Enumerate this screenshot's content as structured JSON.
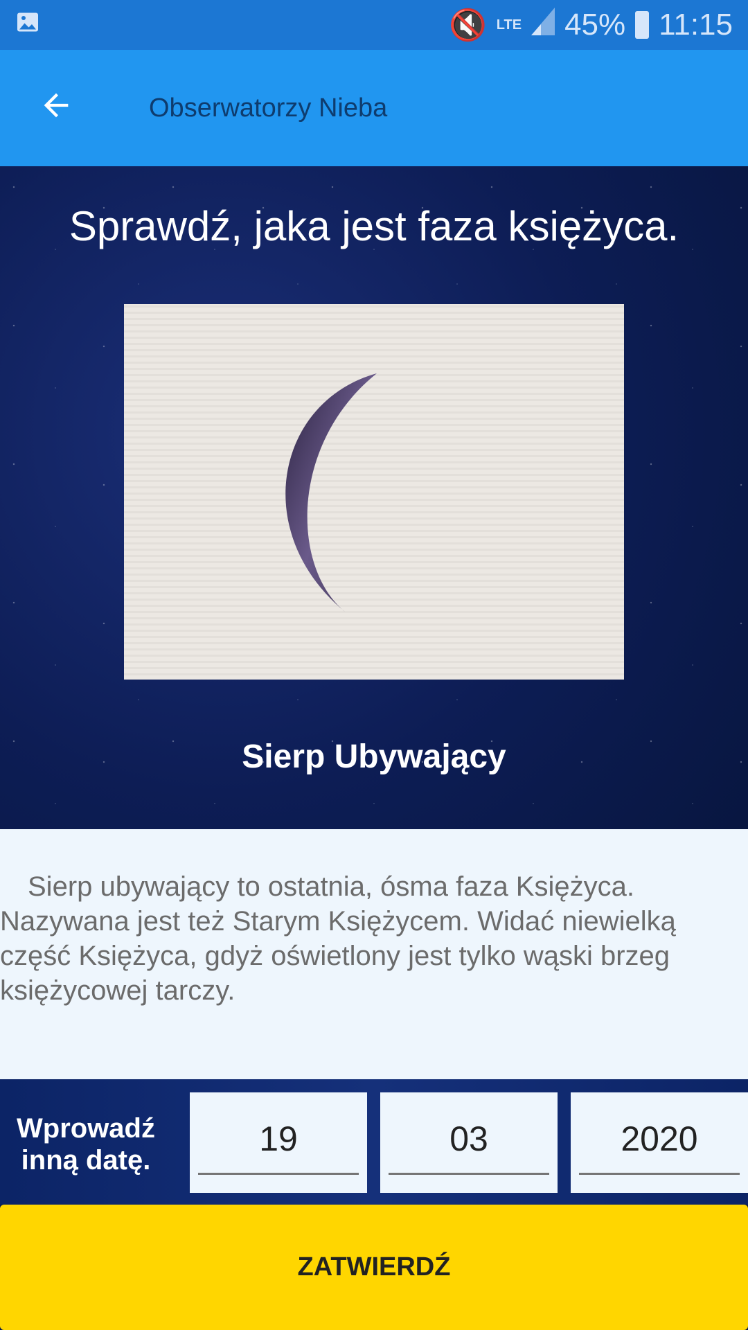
{
  "status_bar": {
    "battery": "45%",
    "time": "11:15",
    "network": "LTE"
  },
  "app_bar": {
    "title": "Obserwatorzy Nieba"
  },
  "main": {
    "headline": "Sprawdź, jaka jest faza księżyca.",
    "phase_name": "Sierp Ubywający",
    "description": "Sierp ubywający to ostatnia, ósma faza Księżyca. Nazywana jest też Starym Księżycem. Widać niewielką część Księżyca, gdyż oświetlony jest tylko wąski brzeg księżycowej tarczy."
  },
  "date_form": {
    "label": "Wprowadź inną datę.",
    "day": "19",
    "month": "03",
    "year": "2020"
  },
  "confirm_button": "ZATWIERDŹ"
}
